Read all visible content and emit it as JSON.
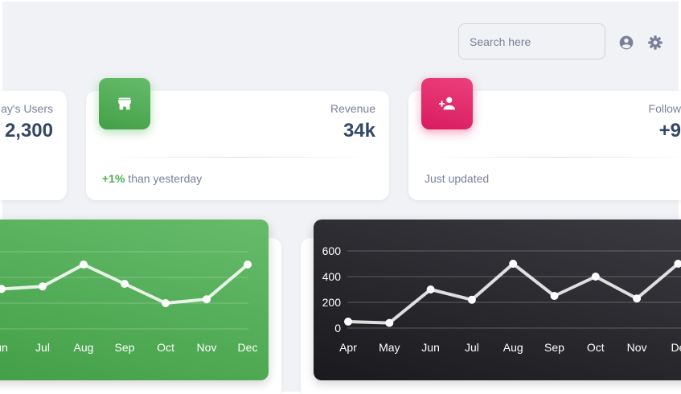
{
  "header": {
    "search": {
      "placeholder": "Search here",
      "value": ""
    },
    "icons": [
      "account-circle-icon",
      "settings-gear-icon"
    ]
  },
  "stats": [
    {
      "label": "ay's Users",
      "value": "2,300"
    },
    {
      "label": "Revenue",
      "value": "34k",
      "footer_pct": "+1%",
      "footer_text": " than yesterday",
      "icon": "store-icon",
      "accent": "#4caf50"
    },
    {
      "label": "Follow",
      "value": "+9",
      "footer_text": "Just updated",
      "icon": "person-add-icon",
      "accent": "#e91e63"
    }
  ],
  "charts": {
    "green": {
      "color": "#4caf50",
      "chart_data": {
        "type": "line",
        "categories": [
          "un",
          "Jul",
          "Aug",
          "Sep",
          "Oct",
          "Nov",
          "Dec"
        ],
        "values": [
          310,
          330,
          500,
          350,
          200,
          230,
          500
        ]
      }
    },
    "dark": {
      "color": "#2a2a2e",
      "chart_data": {
        "type": "line",
        "categories": [
          "Apr",
          "May",
          "Jun",
          "Jul",
          "Aug",
          "Sep",
          "Oct",
          "Nov",
          "De"
        ],
        "values": [
          50,
          40,
          300,
          220,
          500,
          250,
          400,
          230,
          500
        ],
        "y_ticks": [
          "600",
          "400",
          "200",
          "0"
        ],
        "ylim": [
          0,
          600
        ]
      }
    }
  }
}
